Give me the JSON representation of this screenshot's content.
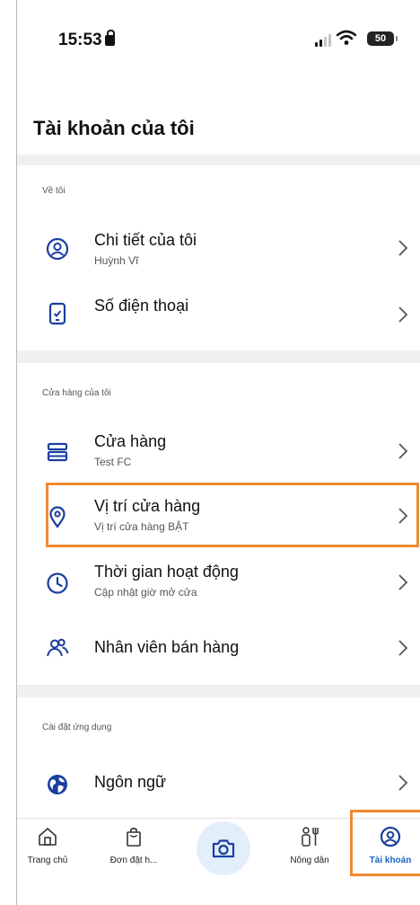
{
  "status_bar": {
    "time": "15:53",
    "battery": "50"
  },
  "page": {
    "title": "Tài khoản của tôi"
  },
  "sections": {
    "about": {
      "header": "Về tôi",
      "items": [
        {
          "label": "Chi tiết của tôi",
          "sub": "Huỳnh Vĩ",
          "icon": "person-circle-icon"
        },
        {
          "label": "Số điện thoại",
          "sub": "",
          "icon": "phone-icon"
        }
      ]
    },
    "store": {
      "header": "Cửa hàng của tôi",
      "items": [
        {
          "label": "Cửa hàng",
          "sub": "Test FC",
          "icon": "store-icon"
        },
        {
          "label": "Vị trí cửa hàng",
          "sub": "Vị trí cửa hàng BẬT",
          "icon": "location-pin-icon"
        },
        {
          "label": "Thời gian hoạt động",
          "sub": "Cập nhật giờ mở cửa",
          "icon": "clock-icon"
        },
        {
          "label": "Nhân viên bán hàng",
          "sub": "",
          "icon": "people-icon"
        }
      ]
    },
    "app_settings": {
      "header": "Cài đặt ứng dụng",
      "items": [
        {
          "label": "Ngôn ngữ",
          "sub": "",
          "icon": "globe-icon"
        }
      ]
    }
  },
  "tabbar": {
    "tabs": [
      {
        "label": "Trang chủ",
        "icon": "home-icon"
      },
      {
        "label": "Đơn đặt h...",
        "icon": "shopping-bag-icon"
      },
      {
        "label": "",
        "icon": "camera-icon"
      },
      {
        "label": "Nông dân",
        "icon": "farmer-icon"
      },
      {
        "label": "Tài khoản",
        "icon": "account-icon",
        "active": true
      }
    ]
  },
  "colors": {
    "accent": "#1a66c9",
    "highlight": "#f08a2e",
    "divider": "#eef0f2"
  }
}
